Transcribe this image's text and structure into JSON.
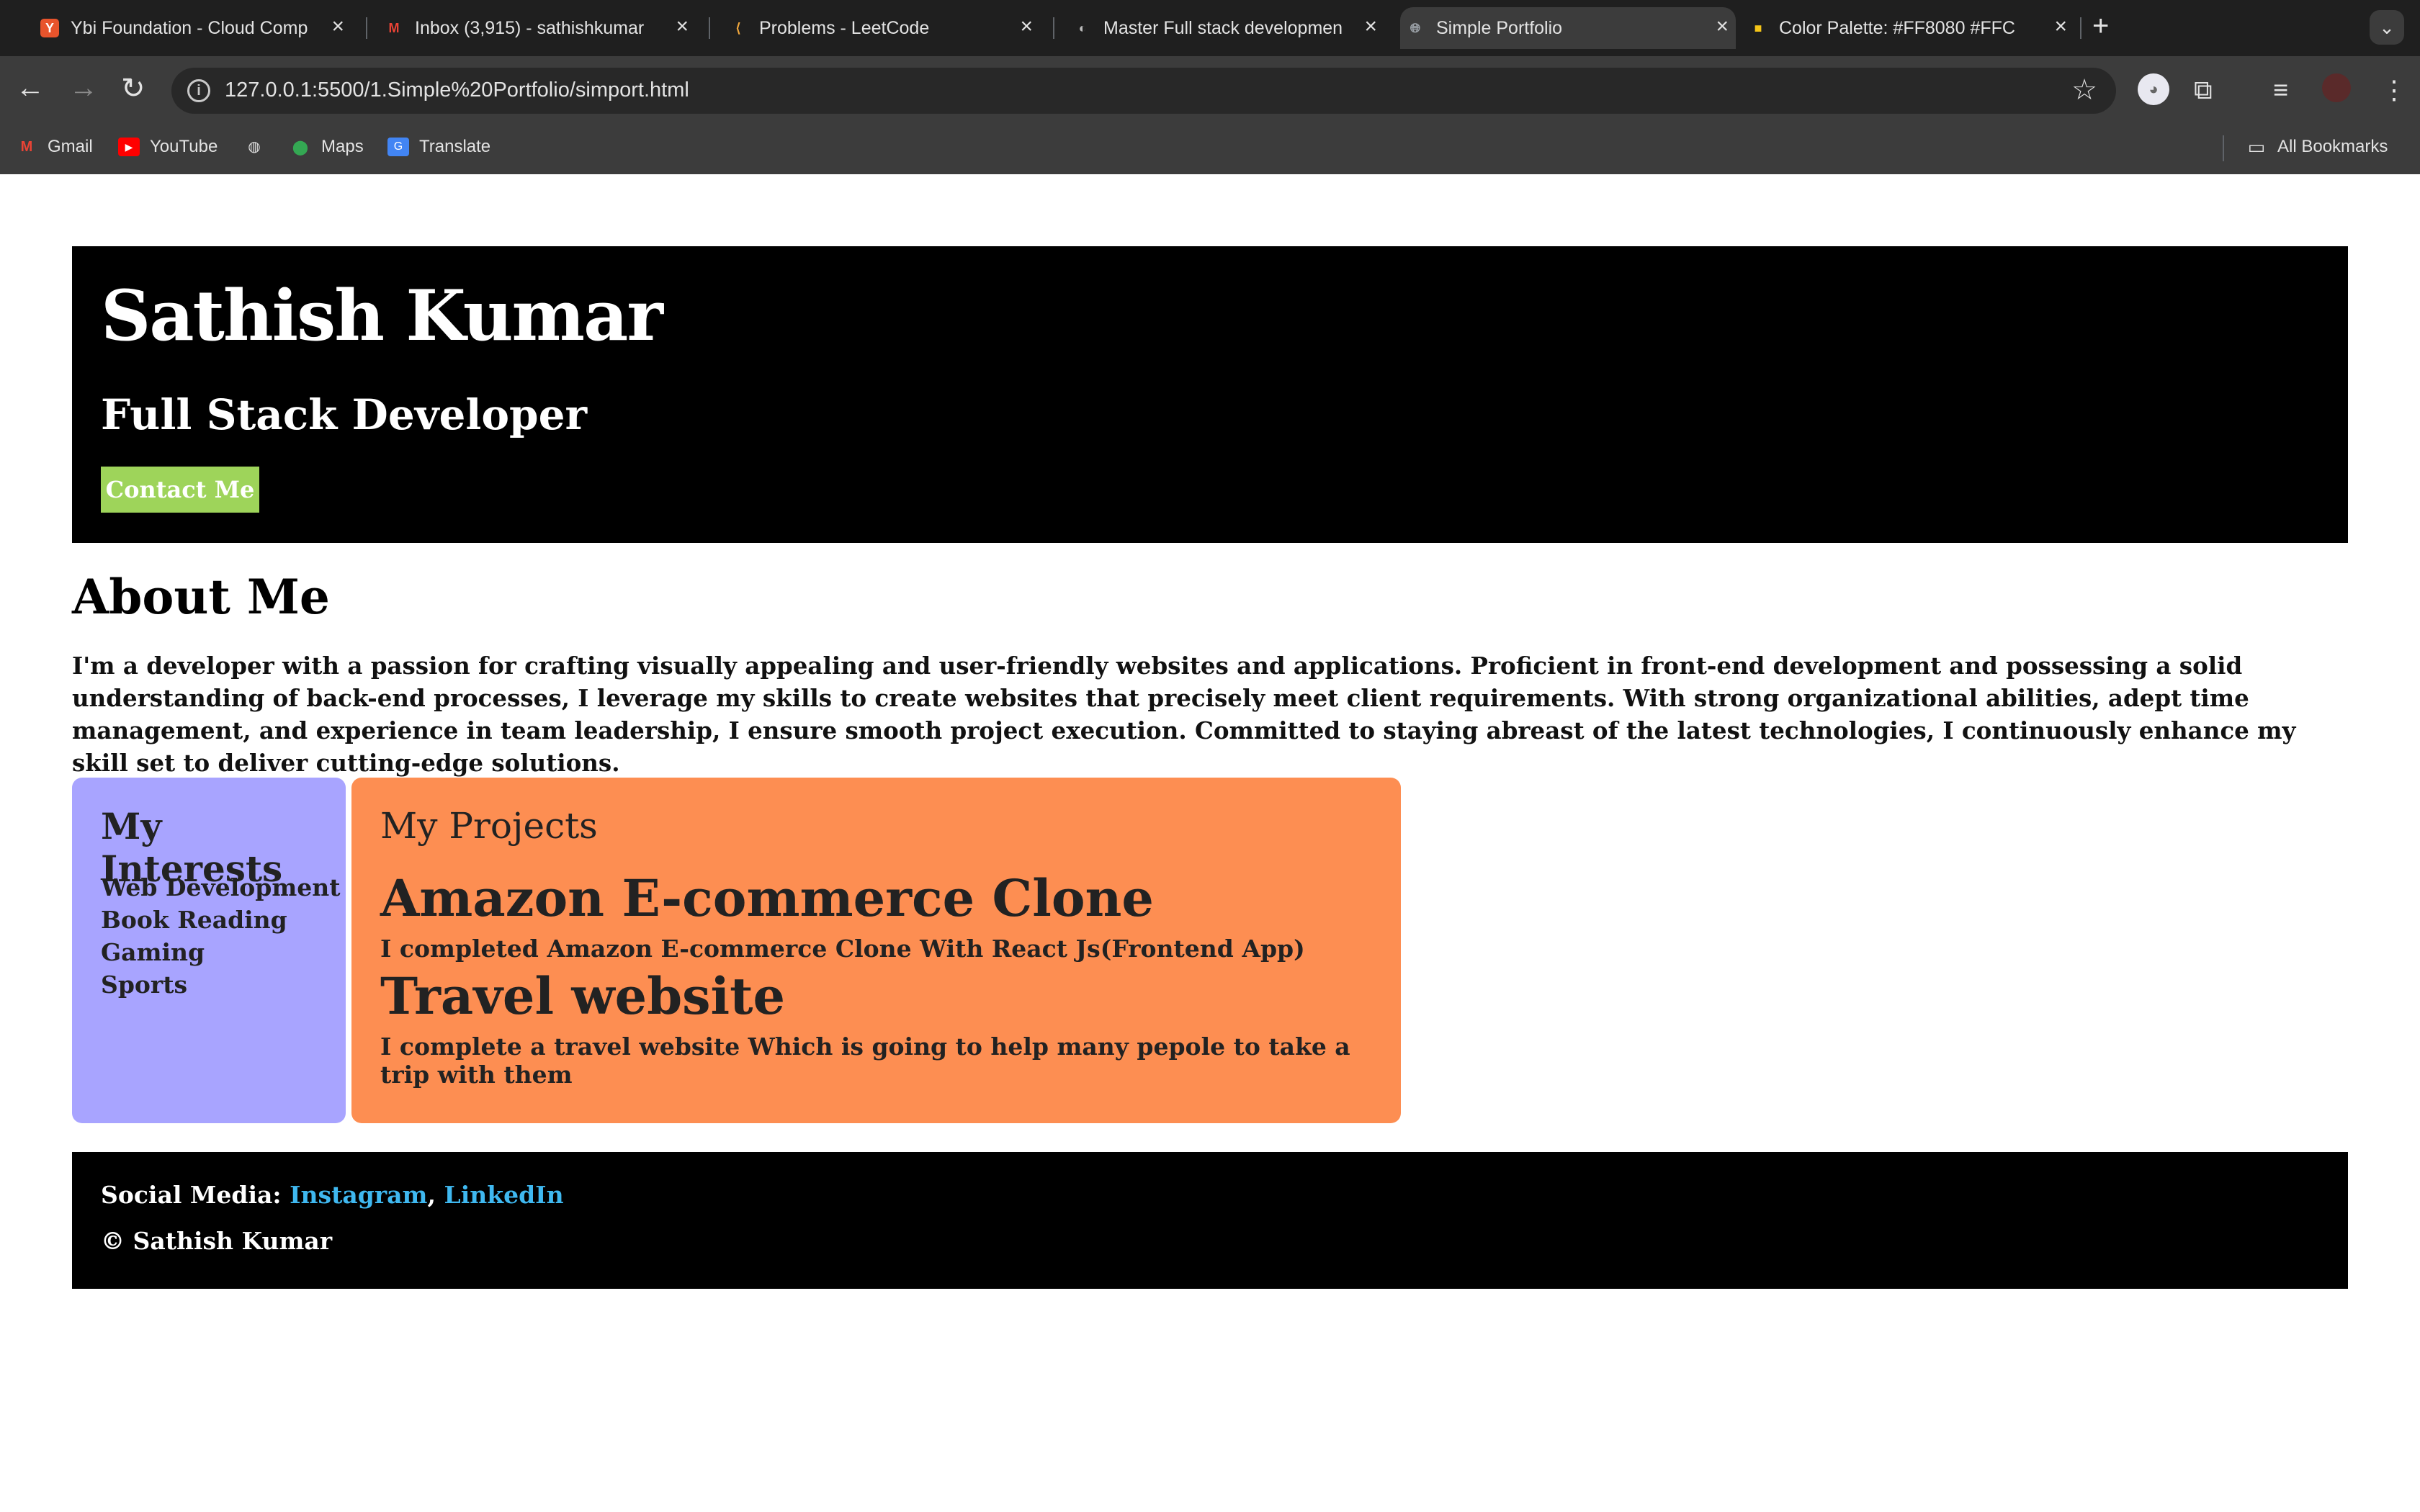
{
  "browser": {
    "tabs": [
      {
        "title": "Ybi Foundation - Cloud Comp",
        "icon": "ybi-favicon",
        "color": "#e8542c"
      },
      {
        "title": "Inbox (3,915) - sathishkumar",
        "icon": "gmail-favicon",
        "color": "#ea4335"
      },
      {
        "title": "Problems - LeetCode",
        "icon": "leetcode-favicon",
        "color": "#f0a73c"
      },
      {
        "title": "Master Full stack developmen",
        "icon": "course-favicon",
        "color": "#555"
      },
      {
        "title": "Simple Portfolio",
        "icon": "globe-favicon",
        "color": "#9aa0a6"
      },
      {
        "title": "Color Palette: #FF8080 #FFC",
        "icon": "palette-favicon",
        "color": "#f5c518"
      }
    ],
    "new_tab": "+",
    "url": "127.0.0.1:5500/1.Simple%20Portfolio/simport.html",
    "bookmarks": [
      {
        "label": "Gmail",
        "icon": "gmail-icon"
      },
      {
        "label": "YouTube",
        "icon": "youtube-icon"
      },
      {
        "label": "",
        "icon": "globe-icon"
      },
      {
        "label": "Maps",
        "icon": "maps-icon"
      },
      {
        "label": "Translate",
        "icon": "translate-icon"
      }
    ],
    "all_bookmarks": "All Bookmarks"
  },
  "header": {
    "name": "Sathish Kumar",
    "role": "Full Stack Developer",
    "contact_label": "Contact Me"
  },
  "about": {
    "title": "About Me",
    "text": "I'm a developer with a passion for crafting visually appealing and user-friendly websites and applications. Proficient in front-end development and possessing a solid understanding of back-end processes, I leverage my skills to create websites that precisely meet client requirements. With strong organizational abilities, adept time management, and experience in team leadership, I ensure smooth project execution. Committed to staying abreast of the latest technologies, I continuously enhance my skill set to deliver cutting-edge solutions."
  },
  "interests": {
    "title": "My Interests",
    "items": [
      "Web Development",
      "Book Reading",
      "Gaming",
      "Sports"
    ]
  },
  "projects": {
    "title": "My Projects",
    "items": [
      {
        "name": "Amazon E-commerce Clone",
        "desc": "I completed Amazon E-commerce Clone With React Js(Frontend App)"
      },
      {
        "name": "Travel website",
        "desc": "I complete a travel website Which is going to help many pepole to take a trip with them"
      }
    ]
  },
  "footer": {
    "social_label": "Social Media:",
    "links": [
      "Instagram",
      "LinkedIn"
    ],
    "separator": ",",
    "copyright": "© Sathish Kumar"
  },
  "colors": {
    "header_bg": "#000000",
    "contact_button": "#9ed45a",
    "interests_bg": "#a8a4ff",
    "projects_bg": "#fd8e52",
    "link": "#3fb8f0"
  }
}
